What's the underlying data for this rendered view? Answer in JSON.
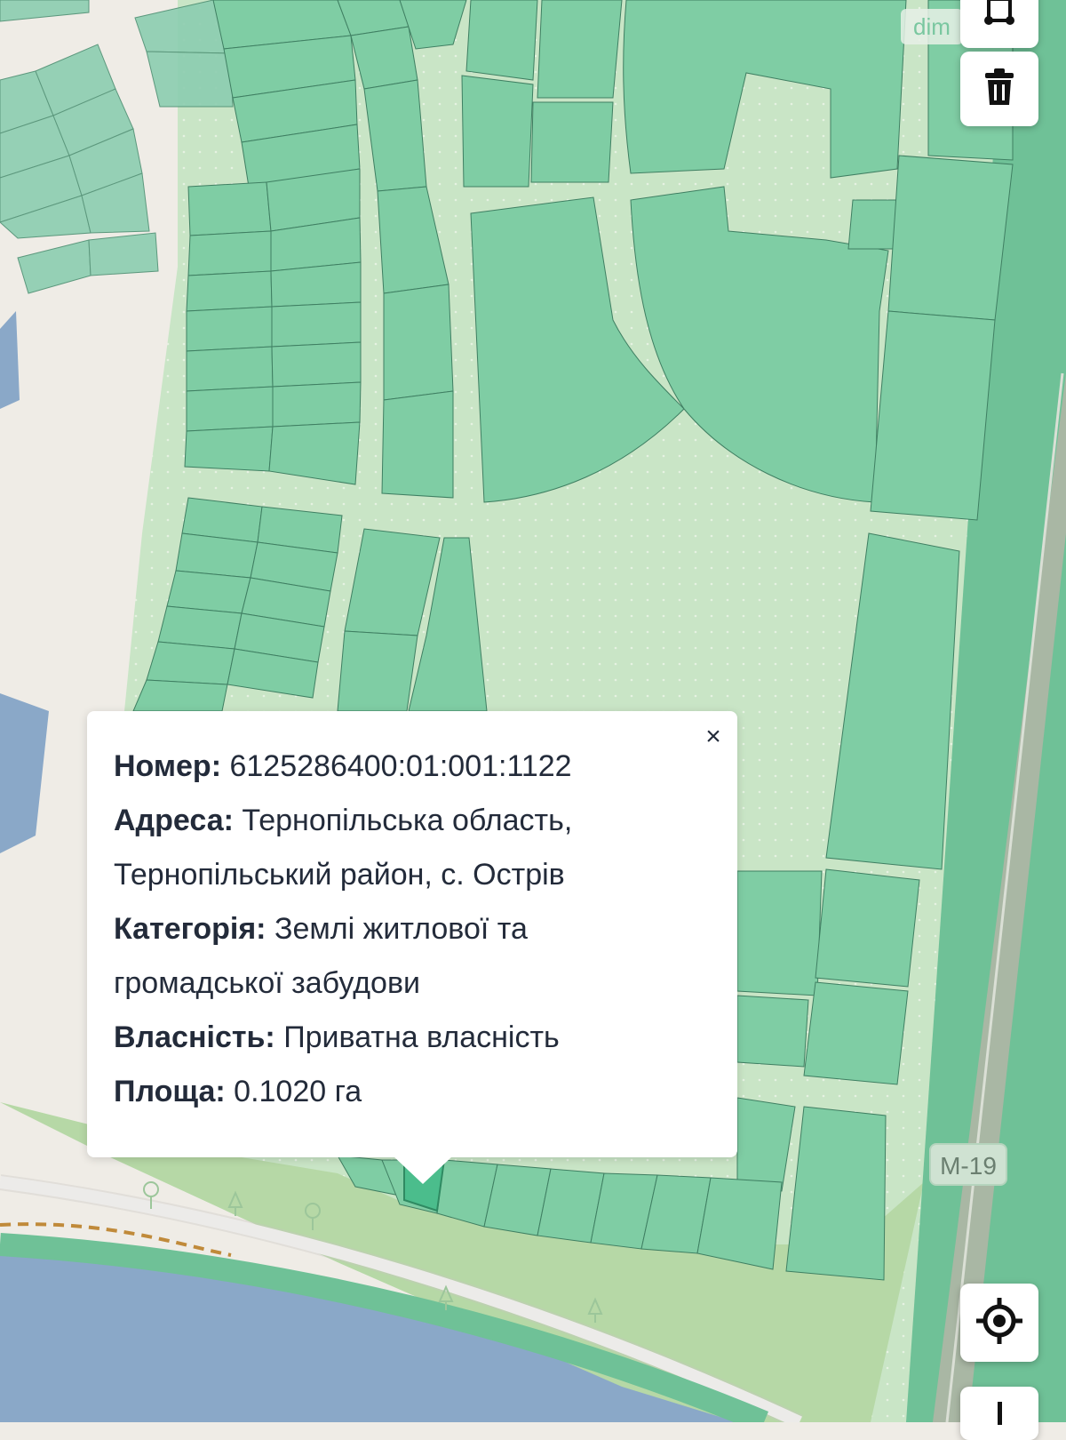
{
  "map": {
    "attribution_fragment": "dim",
    "road_label": "M-19",
    "colors": {
      "background": "#efece6",
      "parcel_fill": "#7fcda4",
      "parcel_light": "#c6e3c3",
      "selected_parcel": "#4bbd8c",
      "water": "#8aa8c8",
      "park": "#b6d8a6"
    }
  },
  "controls": {
    "top_tool_icon": "vertex-edit-icon",
    "trash_icon": "trash-icon",
    "locate_icon": "locate-icon",
    "bottom_icon": "zoom-icon"
  },
  "popup": {
    "close_label": "×",
    "number_label": "Номер:",
    "number_value": "6125286400:01:001:1122",
    "address_label": "Адреса:",
    "address_value_1": "Тернопільська область,",
    "address_value_2": "Тернопільський район, с. Острів",
    "category_label": "Категорія:",
    "category_value_1": "Землі житлової та",
    "category_value_2": "громадської забудови",
    "ownership_label": "Власність:",
    "ownership_value": "Приватна власність",
    "area_label": "Площа:",
    "area_value": "0.1020 га"
  }
}
